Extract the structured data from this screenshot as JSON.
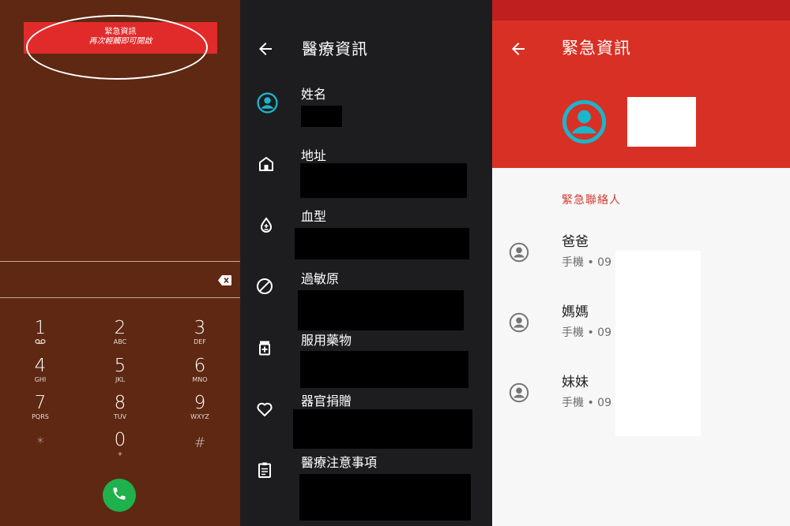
{
  "dialer": {
    "banner_title": "緊急資訊",
    "banner_hint": "再次輕觸即可開啟",
    "keys": [
      {
        "digit": "1",
        "letters": "",
        "voicemail": true
      },
      {
        "digit": "2",
        "letters": "ABC"
      },
      {
        "digit": "3",
        "letters": "DEF"
      },
      {
        "digit": "4",
        "letters": "GHI"
      },
      {
        "digit": "5",
        "letters": "JKL"
      },
      {
        "digit": "6",
        "letters": "MNO"
      },
      {
        "digit": "7",
        "letters": "PQRS"
      },
      {
        "digit": "8",
        "letters": "TUV"
      },
      {
        "digit": "9",
        "letters": "WXYZ"
      },
      {
        "digit": "*",
        "letters": ""
      },
      {
        "digit": "0",
        "letters": "+"
      },
      {
        "digit": "#",
        "letters": ""
      }
    ],
    "colors": {
      "background": "#5e2813",
      "banner": "#e12b2b",
      "call": "#1fb14b"
    },
    "icons": [
      "voicemail-icon",
      "backspace-icon",
      "phone-icon"
    ]
  },
  "medical": {
    "title": "醫療資訊",
    "fields": [
      {
        "label": "姓名",
        "icon": "person-icon"
      },
      {
        "label": "地址",
        "icon": "home-icon"
      },
      {
        "label": "血型",
        "icon": "blood-drop-icon"
      },
      {
        "label": "過敏原",
        "icon": "block-icon"
      },
      {
        "label": "服用藥物",
        "icon": "medication-icon"
      },
      {
        "label": "器官捐贈",
        "icon": "heart-icon"
      },
      {
        "label": "醫療注意事項",
        "icon": "clipboard-icon"
      }
    ],
    "colors": {
      "background": "#1d1d1f",
      "accent": "#1ab6cc"
    }
  },
  "emergency": {
    "title": "緊急資訊",
    "section_label": "緊急聯絡人",
    "contacts": [
      {
        "name": "爸爸",
        "phone": "手機 • 09"
      },
      {
        "name": "媽媽",
        "phone": "手機 • 09"
      },
      {
        "name": "妹妹",
        "phone": "手機 • 09"
      }
    ],
    "colors": {
      "appbar": "#d93025",
      "status_bar": "#bf1f1f",
      "section": "#cf3b32",
      "avatar": "#1ab6cc"
    }
  }
}
